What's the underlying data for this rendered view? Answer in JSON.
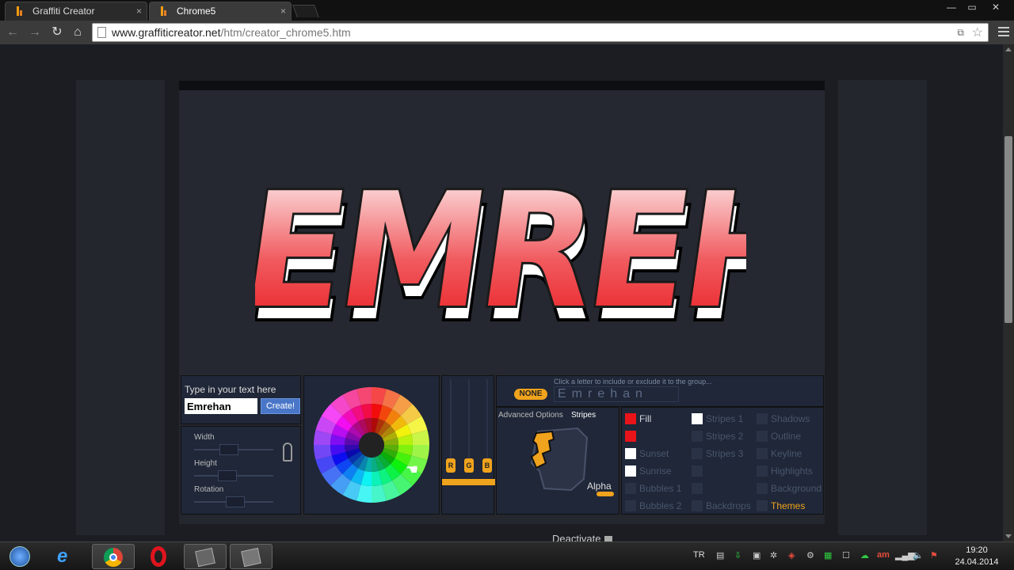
{
  "browser": {
    "tabs": [
      {
        "title": "Graffiti Creator",
        "close": "×"
      },
      {
        "title": "Chrome5",
        "close": "×"
      }
    ],
    "window_controls": {
      "minimize": "—",
      "maximize": "▭",
      "close": "✕"
    },
    "url_domain": "www.graffiticreator.net",
    "url_path": "/htm/creator_chrome5.htm",
    "nav": {
      "back": "←",
      "forward": "→",
      "reload": "↻",
      "home": "⌂"
    },
    "omnibox_icons": {
      "translate": "⧉",
      "star": "☆"
    }
  },
  "graffiti": {
    "text": "EMREHAN",
    "fill_top": "#ffffff",
    "fill_bottom": "#e8141a",
    "outline": "#1a1a1a",
    "shadow": "#ffffff"
  },
  "controls": {
    "input_label": "Type in your text here",
    "input_value": "Emrehan",
    "create_label": "Create!",
    "sliders": [
      {
        "label": "Width"
      },
      {
        "label": "Height"
      },
      {
        "label": "Rotation"
      }
    ],
    "rgb": [
      "R",
      "G",
      "B"
    ],
    "hint": "Click a letter to include or exclude it to the group...",
    "none_label": "NONE",
    "letters": "Emrehan",
    "advanced_label": "Advanced Options",
    "stripes_label": "Stripes",
    "alpha_label": "Alpha",
    "deactivate_label": "Deactivate",
    "options": {
      "col1": [
        "Fill",
        "",
        "Sunset",
        "Sunrise",
        "Bubbles 1",
        "Bubbles 2"
      ],
      "col2": [
        "Stripes 1",
        "Stripes 2",
        "Stripes 3",
        "",
        "",
        "Backdrops"
      ],
      "col3": [
        "Shadows",
        "Outline",
        "Keyline",
        "Highlights",
        "Background",
        "Themes"
      ]
    },
    "swatch_colors": {
      "red": "#e8141a",
      "white": "#ffffff",
      "empty": "#2a3346"
    }
  },
  "taskbar": {
    "lang": "TR",
    "time": "19:20",
    "date": "24.04.2014"
  }
}
